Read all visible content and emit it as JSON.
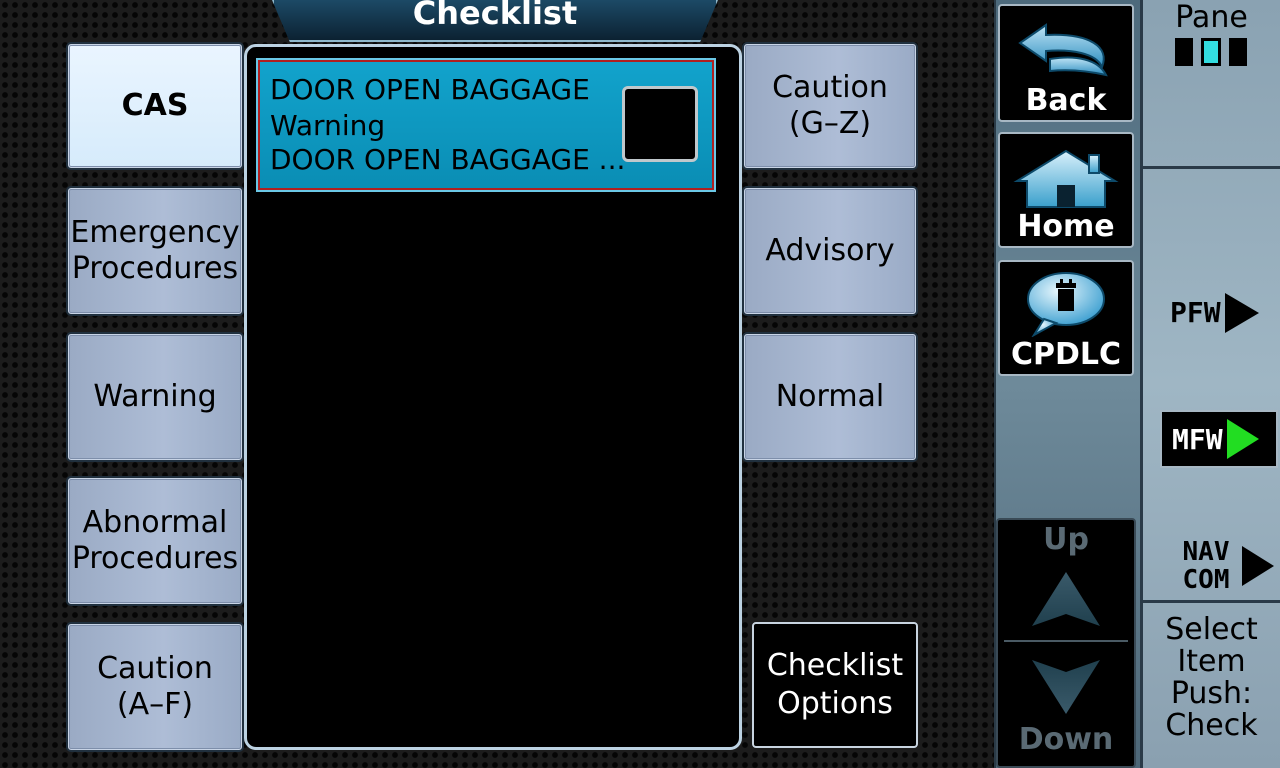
{
  "header": {
    "title": "Checklist"
  },
  "left_categories": [
    {
      "label": "CAS",
      "active": true
    },
    {
      "label": "Emergency\nProcedures",
      "active": false
    },
    {
      "label": "Warning",
      "active": false
    },
    {
      "label": "Abnormal\nProcedures",
      "active": false
    },
    {
      "label": "Caution\n(A–F)",
      "active": false
    }
  ],
  "right_categories": [
    {
      "label": "Caution\n(G–Z)"
    },
    {
      "label": "Advisory"
    },
    {
      "label": "Normal"
    }
  ],
  "checklist_items": [
    {
      "line1": "DOOR OPEN BAGGAGE",
      "line2": "Warning",
      "line3": "DOOR OPEN BAGGAGE ...",
      "checked": false
    }
  ],
  "options_button": {
    "label": "Checklist\nOptions"
  },
  "nav_buttons": {
    "back": {
      "label": "Back",
      "icon": "back-arrow-icon"
    },
    "home": {
      "label": "Home",
      "icon": "home-icon"
    },
    "cpdlc": {
      "label": "CPDLC",
      "icon": "cpdlc-speech-bubble-icon"
    }
  },
  "scroll": {
    "up_label": "Up",
    "down_label": "Down"
  },
  "softkeys": {
    "pane_label": "Pane",
    "pfw_label": "PFW",
    "mfw_label": "MFW",
    "navcom_label_line1": "NAV",
    "navcom_label_line2": "COM",
    "knob_hint": "Select\nItem\nPush:\nCheck"
  },
  "colors": {
    "selected_item": "#0a9ac2",
    "mfw_active_arrow": "#22dd22",
    "pane_active": "#33dde0"
  }
}
